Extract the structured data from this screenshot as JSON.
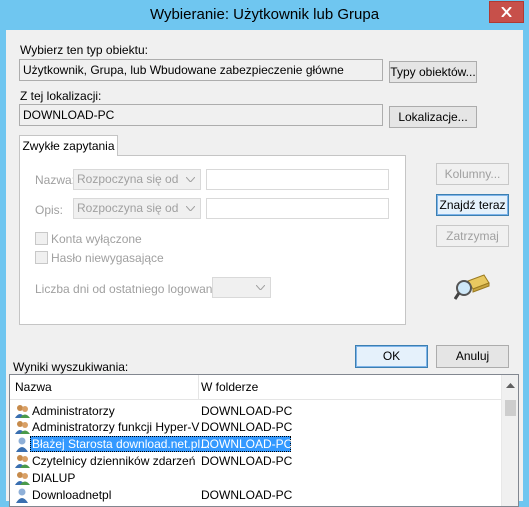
{
  "window": {
    "title": "Wybieranie: Użytkownik lub Grupa"
  },
  "object_type": {
    "label": "Wybierz ten typ obiektu:",
    "value": "Użytkownik, Grupa, lub Wbudowane zabezpieczenie główne",
    "button": "Typy obiektów..."
  },
  "location": {
    "label": "Z tej lokalizacji:",
    "value": "DOWNLOAD-PC",
    "button": "Lokalizacje..."
  },
  "tab": {
    "label": "Zwykłe zapytania"
  },
  "query": {
    "name_label": "Nazwa:",
    "name_mode": "Rozpoczyna się od",
    "desc_label": "Opis:",
    "desc_mode": "Rozpoczyna się od",
    "disabled_accounts": "Konta wyłączone",
    "non_expiring_pwd": "Hasło niewygasające",
    "days_label": "Liczba dni od ostatniego logowania:"
  },
  "side_buttons": {
    "columns": "Kolumny...",
    "find_now": "Znajdź teraz",
    "stop": "Zatrzymaj"
  },
  "dialog_buttons": {
    "ok": "OK",
    "cancel": "Anuluj"
  },
  "results": {
    "label": "Wyniki wyszukiwania:",
    "headers": {
      "name": "Nazwa",
      "folder": "W folderze"
    },
    "rows": [
      {
        "name": "Administratorzy",
        "folder": "DOWNLOAD-PC",
        "icon": "group-icon"
      },
      {
        "name": "Administratorzy funkcji Hyper-V",
        "folder": "DOWNLOAD-PC",
        "icon": "group-icon"
      },
      {
        "name": "Błażej Starosta download.net.pl...",
        "folder": "DOWNLOAD-PC",
        "icon": "user-icon",
        "selected": true
      },
      {
        "name": "Czytelnicy dzienników zdarzeń",
        "folder": "DOWNLOAD-PC",
        "icon": "group-icon"
      },
      {
        "name": "DIALUP",
        "folder": "",
        "icon": "group-icon"
      },
      {
        "name": "Downloadnetpl",
        "folder": "DOWNLOAD-PC",
        "icon": "user-icon"
      }
    ]
  },
  "colors": {
    "titlebar": "#6fc6f0",
    "selection": "#3399ff",
    "close": "#c7504a"
  }
}
